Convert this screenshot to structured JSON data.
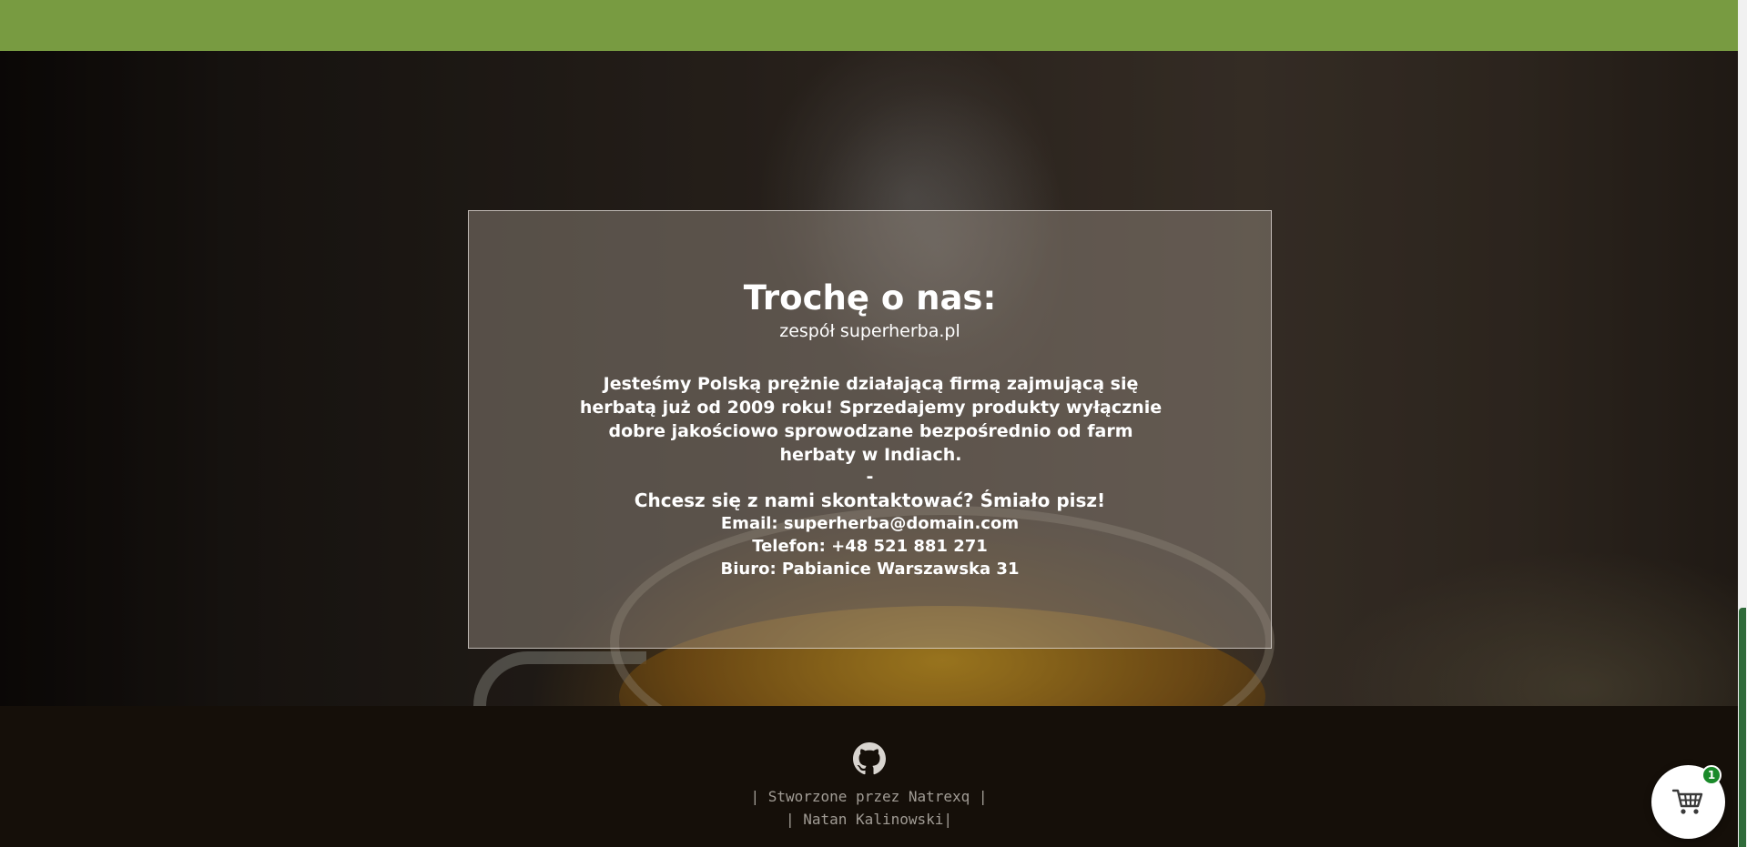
{
  "about": {
    "title": "Trochę o nas:",
    "subtitle": "zespół superherba.pl",
    "body": "Jesteśmy Polską prężnie działającą firmą zajmującą się herbatą już od 2009 roku! Sprzedajemy produkty wyłącznie dobre jakościowo sprowodzane bezpośrednio od farm herbaty w Indiach.",
    "separator": "-",
    "contact_question": "Chcesz się z nami skontaktować? Śmiało pisz!",
    "email": "Email: superherba@domain.com",
    "phone": "Telefon: +48 521 881 271",
    "office": "Biuro: Pabianice Warszawska 31"
  },
  "footer": {
    "github_icon": "github-icon",
    "credit_line1": "| Stworzone przez Natrexq |",
    "credit_line2": "| Natan Kalinowski|"
  },
  "cart": {
    "icon": "cart-icon",
    "count": "1"
  },
  "colors": {
    "topbar": "#789b41",
    "footer_bg": "#150f09",
    "badge": "#1a8a2a"
  }
}
